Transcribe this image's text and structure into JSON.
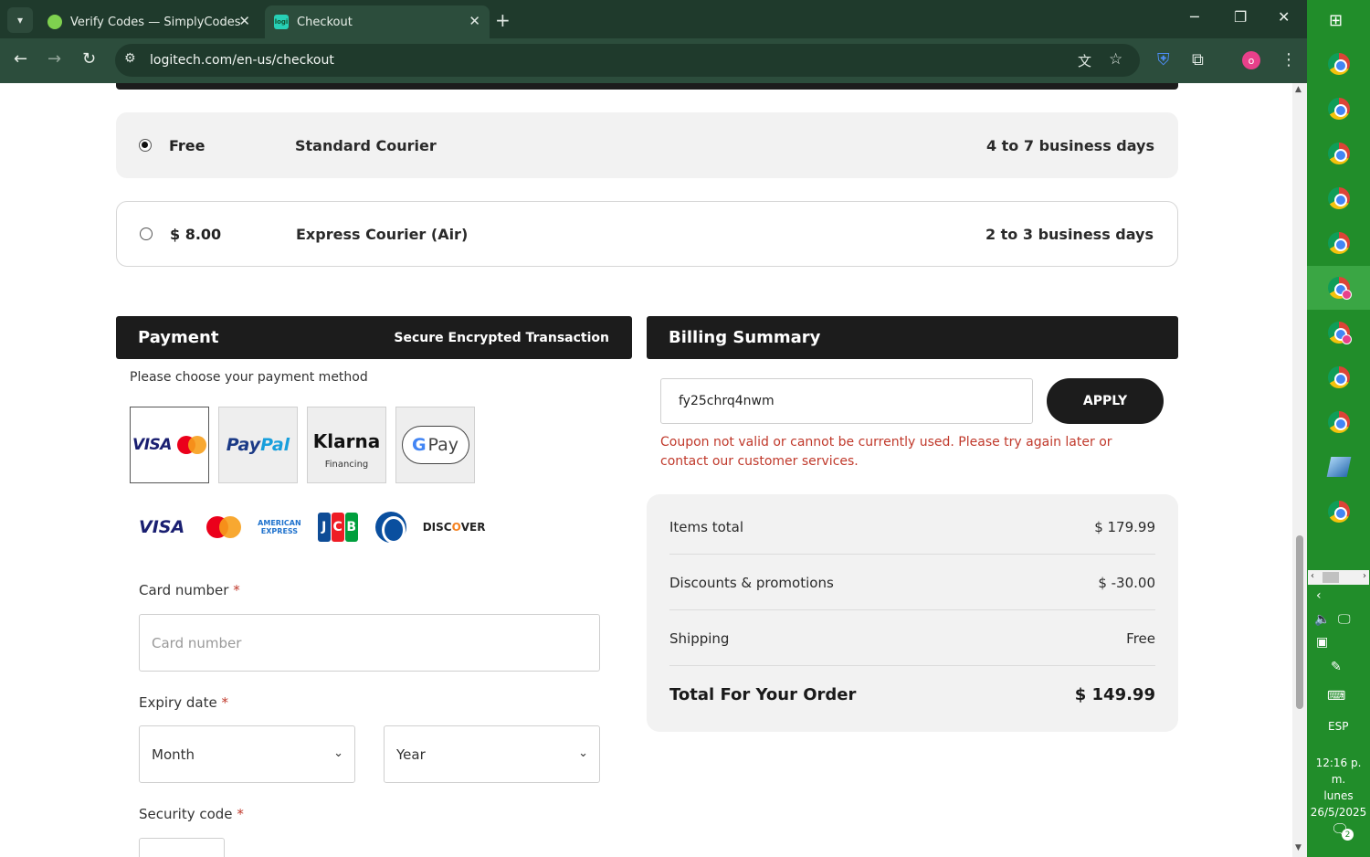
{
  "browser": {
    "tabs": [
      {
        "title": "Verify Codes — SimplyCodes",
        "active": false
      },
      {
        "title": "Checkout",
        "active": true
      }
    ],
    "url": "logitech.com/en-us/checkout",
    "profile_initial": "o",
    "theme_color": "#2c4d3c"
  },
  "shipping": {
    "options": [
      {
        "price": "Free",
        "method": "Standard Courier",
        "days": "4 to 7 business days",
        "selected": true
      },
      {
        "price": "$ 8.00",
        "method": "Express Courier (Air)",
        "days": "2 to 3 business days",
        "selected": false
      }
    ]
  },
  "payment": {
    "title": "Payment",
    "secure_label": "Secure Encrypted Transaction",
    "choose_label": "Please choose your payment method",
    "methods": {
      "card": {
        "visa": "VISA",
        "icon": "mastercard-icon",
        "selected": true
      },
      "paypal": {
        "pay": "Pay",
        "pal": "Pal"
      },
      "klarna": {
        "name": "Klarna",
        "sub": "Financing"
      },
      "gpay": {
        "g": "G",
        "pay": "Pay"
      }
    },
    "brands": {
      "visa": "VISA",
      "amex_line1": "AMERICAN",
      "amex_line2": "EXPRESS",
      "jcb": [
        "J",
        "C",
        "B"
      ],
      "discover_pre": "DISC",
      "discover_o": "O",
      "discover_post": "VER"
    },
    "card_number": {
      "label": "Card number",
      "placeholder": "Card number",
      "value": ""
    },
    "expiry": {
      "label": "Expiry date",
      "month": "Month",
      "year": "Year"
    },
    "security_code": {
      "label": "Security code",
      "value": ""
    },
    "required_mark": "*"
  },
  "billing": {
    "title": "Billing Summary",
    "coupon_value": "fy25chrq4nwm",
    "apply_label": "APPLY",
    "coupon_error": "Coupon not valid or cannot be currently used. Please try again later or contact our customer services.",
    "rows": [
      {
        "label": "Items total",
        "value": "$ 179.99"
      },
      {
        "label": "Discounts & promotions",
        "value": "$ -30.00"
      },
      {
        "label": "Shipping",
        "value": "Free"
      }
    ],
    "total": {
      "label": "Total For Your Order",
      "value": "$ 149.99"
    }
  },
  "taskbar": {
    "language": "ESP",
    "time": "12:16 p. m.",
    "day": "lunes",
    "date": "26/5/2025",
    "notification_count": "2",
    "accent": "#218d2a"
  }
}
